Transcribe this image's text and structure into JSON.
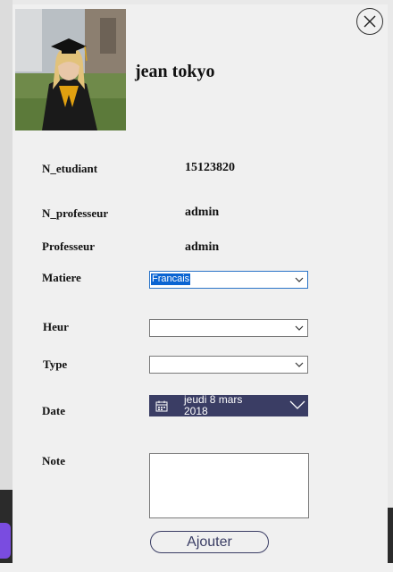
{
  "student": {
    "name": "jean tokyo",
    "photo_icon": "graduate-photo"
  },
  "fields": {
    "n_etudiant_label": "N_etudiant",
    "n_etudiant_value": "15123820",
    "n_professeur_label": "N_professeur",
    "n_professeur_value": "admin",
    "professeur_label": "Professeur",
    "professeur_value": "admin",
    "matiere_label": "Matiere",
    "matiere_value": "Francais",
    "heur_label": "Heur",
    "heur_value": "",
    "type_label": "Type",
    "type_value": "",
    "date_label": "Date",
    "date_value": "jeudi 8 mars 2018",
    "note_label": "Note",
    "note_value": ""
  },
  "actions": {
    "add_label": "Ajouter",
    "close_icon": "close-icon"
  },
  "colors": {
    "accent": "#3a3d64",
    "selection": "#0a64d2",
    "window_bg": "#f0f0f0"
  }
}
